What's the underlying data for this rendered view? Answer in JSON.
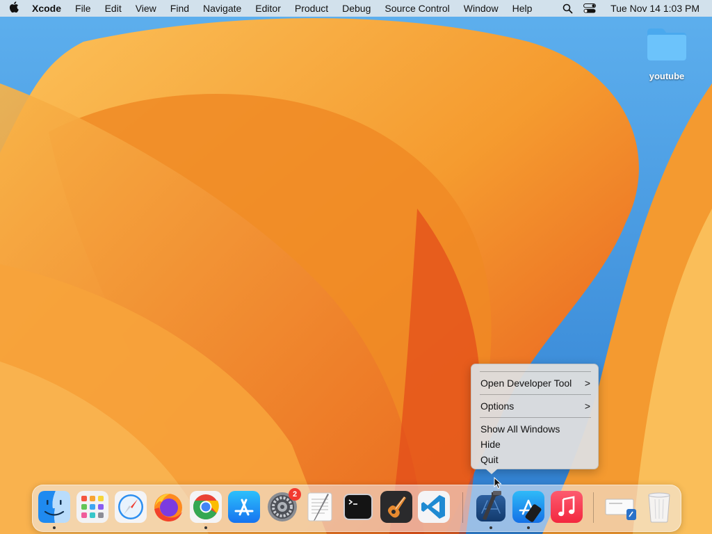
{
  "menubar": {
    "apple_icon": "apple-icon",
    "app_name": "Xcode",
    "items": [
      "File",
      "Edit",
      "View",
      "Find",
      "Navigate",
      "Editor",
      "Product",
      "Debug",
      "Source Control",
      "Window",
      "Help"
    ],
    "status_icons": [
      "search-icon",
      "control-center-icon"
    ],
    "clock": "Tue Nov 14  1:03 PM"
  },
  "desktop": {
    "folder": {
      "label": "youtube",
      "icon": "folder-icon",
      "color": "#5bb8f5"
    }
  },
  "context_menu": {
    "items": [
      {
        "label": "Open Developer Tool",
        "has_submenu": true
      },
      {
        "label": "Options",
        "has_submenu": true
      },
      {
        "label": "Show All Windows",
        "has_submenu": false
      },
      {
        "label": "Hide",
        "has_submenu": false
      },
      {
        "label": "Quit",
        "has_submenu": false
      }
    ],
    "chevron": ">"
  },
  "dock": {
    "apps": [
      {
        "name": "Finder",
        "icon": "finder-icon",
        "running": true
      },
      {
        "name": "Launchpad",
        "icon": "launchpad-icon",
        "running": false
      },
      {
        "name": "Safari",
        "icon": "safari-icon",
        "running": false
      },
      {
        "name": "Firefox",
        "icon": "firefox-icon",
        "running": false
      },
      {
        "name": "Google Chrome",
        "icon": "chrome-icon",
        "running": true
      },
      {
        "name": "App Store",
        "icon": "app-store-icon",
        "running": false
      },
      {
        "name": "System Preferences",
        "icon": "system-preferences-icon",
        "running": false,
        "badge": "2"
      },
      {
        "name": "TextEdit",
        "icon": "textedit-icon",
        "running": false
      },
      {
        "name": "Terminal",
        "icon": "terminal-icon",
        "running": false
      },
      {
        "name": "GarageBand",
        "icon": "garageband-icon",
        "running": false
      },
      {
        "name": "Visual Studio Code",
        "icon": "vscode-icon",
        "running": false
      },
      {
        "name": "Xcode",
        "icon": "xcode-icon",
        "running": true
      },
      {
        "name": "Simulator",
        "icon": "simulator-icon",
        "running": true
      },
      {
        "name": "Music",
        "icon": "music-icon",
        "running": false
      }
    ],
    "others": [
      {
        "name": "Downloads",
        "icon": "downloads-stack-icon"
      },
      {
        "name": "Trash",
        "icon": "trash-icon"
      }
    ]
  }
}
